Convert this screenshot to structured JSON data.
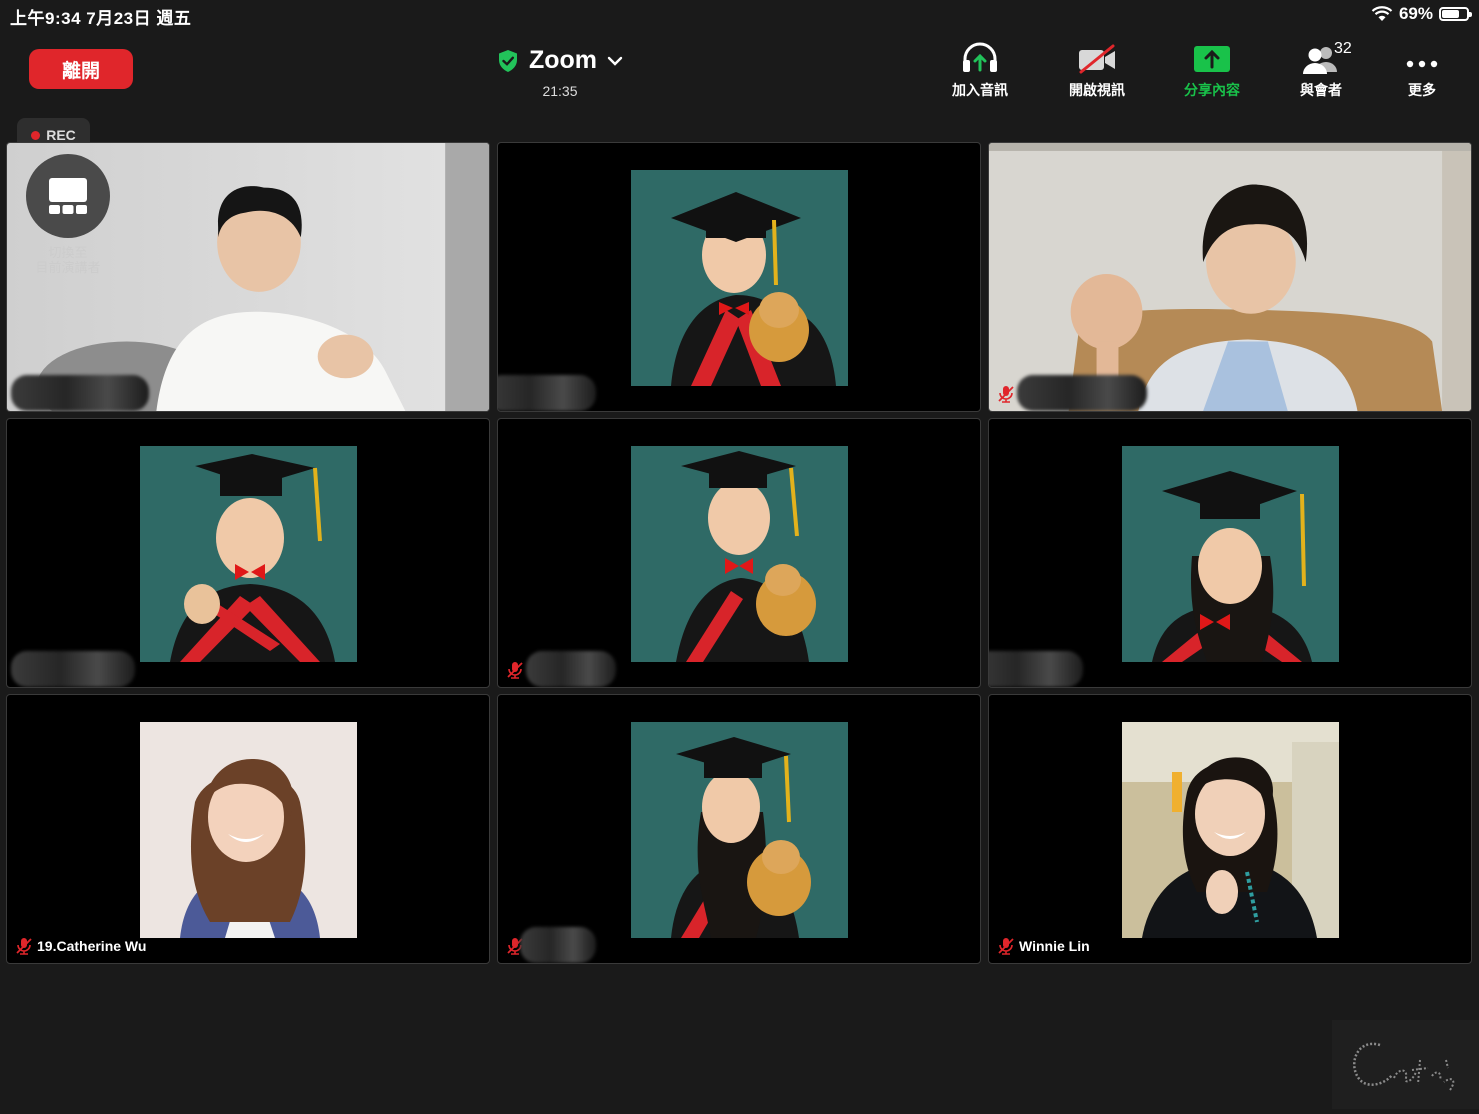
{
  "status_bar": {
    "time": "上午9:34   7月23日 週五",
    "battery_percent": "69%",
    "battery_level": 0.69
  },
  "header": {
    "leave_label": "離開",
    "meeting_title": "Zoom",
    "meeting_timer": "21:35"
  },
  "toolbar": {
    "join_audio": "加入音訊",
    "start_video": "開啟視訊",
    "share_content": "分享內容",
    "participants": "與會者",
    "participants_count": "32",
    "more": "更多"
  },
  "recording": {
    "label": "REC"
  },
  "switch_speaker": {
    "label_line1": "切換至",
    "label_line2": "目前演講者"
  },
  "participants": [
    {
      "name": "",
      "muted": false
    },
    {
      "name": "",
      "muted": false
    },
    {
      "name": "",
      "muted": true
    },
    {
      "name": "",
      "muted": false
    },
    {
      "name": "",
      "muted": true
    },
    {
      "name": "",
      "muted": false
    },
    {
      "name": "19.Catherine Wu",
      "muted": true
    },
    {
      "name": "",
      "muted": true
    },
    {
      "name": "Winnie Lin",
      "muted": true
    }
  ],
  "colors": {
    "leave_red": "#e0262b",
    "share_green": "#19c24a",
    "chalkboard": "#2f6a66",
    "gown_red": "#d8242a"
  },
  "watermark": "Cat's"
}
